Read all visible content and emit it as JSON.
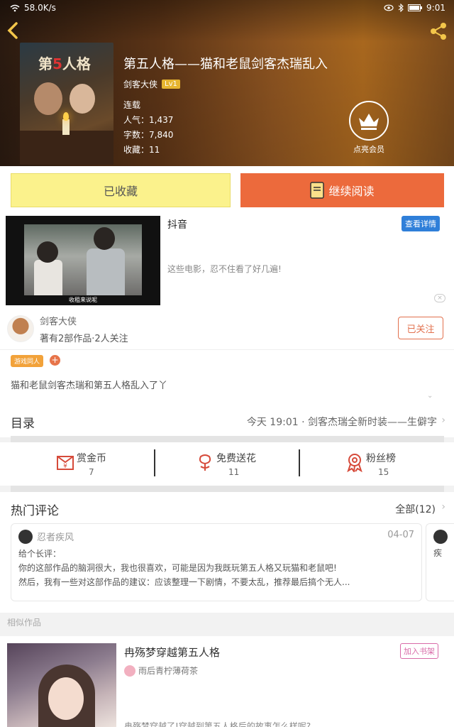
{
  "status": {
    "speed": "58.0K/s",
    "time": "9:01"
  },
  "book": {
    "title": "第五人格——猫和老鼠剑客杰瑞乱入",
    "author": "剑客大侠",
    "level": "Lv1",
    "state": "连载",
    "popularity": "人气：1,437",
    "words": "字数：7,840",
    "favorites": "收藏：11",
    "cover_title_pre": "第",
    "cover_title_mid": "5",
    "cover_title_post": "人格",
    "vip_label": "点亮会员"
  },
  "actions": {
    "fav_label": "已收藏",
    "read_label": "继续阅读"
  },
  "ad": {
    "title": "抖音",
    "desc": "这些电影，忍不住看了好几遍!",
    "detail_label": "查看详情",
    "video_caption": "收租来说呢",
    "close": "×"
  },
  "author_card": {
    "name": "剑客大侠",
    "info": "著有2部作品·2人关注",
    "follow_label": "已关注",
    "tag": "游戏同人",
    "tag_add": "+",
    "summary": "猫和老鼠剑客杰瑞和第五人格乱入了丫",
    "expand": "⌄"
  },
  "directory": {
    "label": "目录",
    "latest": "今天 19:01 · 剑客杰瑞全新时装——生僻字",
    "chevron": "›"
  },
  "stats": [
    {
      "label": "赏金币",
      "value": "7",
      "icon": "coin-icon"
    },
    {
      "label": "免费送花",
      "value": "11",
      "icon": "flower-icon"
    },
    {
      "label": "粉丝榜",
      "value": "15",
      "icon": "ribbon-icon"
    }
  ],
  "comments": {
    "title": "热门评论",
    "all_label": "全部(12)",
    "chevron": "›",
    "items": [
      {
        "user": "忍者疾风",
        "date": "04-07",
        "line1": "给个长评：",
        "line2": "你的这部作品的脑洞很大，我也很喜欢，可能是因为我既玩第五人格又玩猫和老鼠吧!",
        "line3": "然后，我有一些对这部作品的建议：应该整理一下剧情，不要太乱，推荐最后搞个无人..."
      },
      {
        "user": "疾",
        "text": "疾"
      }
    ]
  },
  "similar": {
    "label": "相似作品",
    "title": "冉殇梦穿越第五人格",
    "add_label": "加入书架",
    "author": "雨后青柠薄荷茶",
    "desc": "冉殇梦穿越了!穿越到第五人格后的故事怎么样呢?"
  },
  "colors": {
    "accent": "#ec6a3c",
    "fav": "#fbf28c",
    "detail": "#2f7fd9"
  }
}
